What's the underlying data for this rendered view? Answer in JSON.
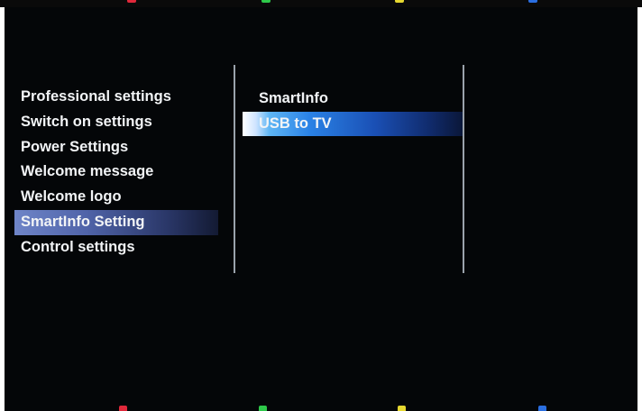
{
  "colors": {
    "red_key": "#e0283a",
    "green_key": "#2ec84a",
    "yellow_key": "#e6d830",
    "blue_key": "#2a6ee0",
    "menu_highlight": "#5064a9",
    "submenu_highlight": "#2a82e6"
  },
  "main_menu": {
    "items": [
      {
        "label": "Professional settings"
      },
      {
        "label": "Switch on settings"
      },
      {
        "label": "Power Settings"
      },
      {
        "label": "Welcome message"
      },
      {
        "label": "Welcome logo"
      },
      {
        "label": "SmartInfo Setting"
      },
      {
        "label": "Control settings"
      }
    ],
    "selected_label": "SmartInfo Setting"
  },
  "sub_menu": {
    "items": [
      {
        "label": "SmartInfo"
      },
      {
        "label": "USB to TV"
      }
    ],
    "selected_label": "USB to TV"
  },
  "color_keys": [
    {
      "name": "red-key-icon"
    },
    {
      "name": "green-key-icon"
    },
    {
      "name": "yellow-key-icon"
    },
    {
      "name": "blue-key-icon"
    }
  ]
}
